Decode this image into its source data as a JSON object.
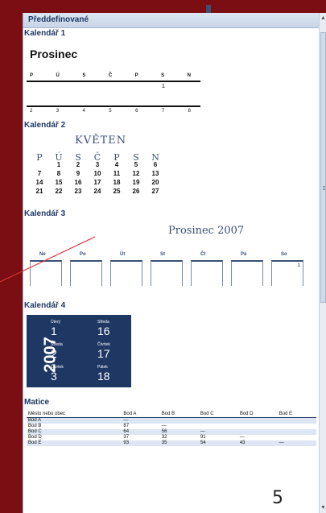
{
  "panel": {
    "header": "Předdefinované",
    "sections": [
      {
        "label": "Kalendář 1"
      },
      {
        "label": "Kalendář 2"
      },
      {
        "label": "Kalendář 3"
      },
      {
        "label": "Kalendář 4"
      },
      {
        "label": "Matice"
      }
    ]
  },
  "cal1": {
    "title": "Prosinec",
    "days": [
      "P",
      "Ú",
      "S",
      "Č",
      "P",
      "S",
      "N"
    ],
    "first": "1",
    "row2": [
      "2",
      "3",
      "4",
      "5",
      "6",
      "7",
      "8"
    ]
  },
  "cal2": {
    "title": "KVĚTEN",
    "days": [
      "P",
      "Ú",
      "S",
      "Č",
      "P",
      "S",
      "N"
    ],
    "rows": [
      [
        "",
        "1",
        "2",
        "3",
        "4",
        "5",
        "6"
      ],
      [
        "7",
        "8",
        "9",
        "10",
        "11",
        "12",
        "13"
      ],
      [
        "14",
        "15",
        "16",
        "17",
        "18",
        "19",
        "20"
      ],
      [
        "21",
        "22",
        "23",
        "24",
        "25",
        "26",
        "27"
      ]
    ]
  },
  "cal3": {
    "title": "Prosinec 2007",
    "days": [
      "Ne",
      "Po",
      "Út",
      "St",
      "Čt",
      "Pá",
      "So"
    ],
    "first": "1"
  },
  "cal4": {
    "year": "2007",
    "cells": [
      {
        "weekday": "Úterý",
        "day": "1"
      },
      {
        "weekday": "Středa",
        "day": "16"
      },
      {
        "weekday": "Středa",
        "day": "2"
      },
      {
        "weekday": "Čtvrtek",
        "day": "17"
      },
      {
        "weekday": "Čtvrtek",
        "day": "3"
      },
      {
        "weekday": "Pátek",
        "day": "18"
      }
    ]
  },
  "matrix": {
    "headers": [
      "Město nebo obec",
      "Bod A",
      "Bod B",
      "Bod C",
      "Bod D",
      "Bod E"
    ],
    "rows": [
      [
        "Bod A",
        "—",
        "",
        "",
        "",
        ""
      ],
      [
        "Bod B",
        "87",
        "—",
        "",
        "",
        ""
      ],
      [
        "Bod C",
        "64",
        "56",
        "—",
        "",
        ""
      ],
      [
        "Bod D",
        "37",
        "32",
        "91",
        "—",
        ""
      ],
      [
        "Bod E",
        "93",
        "35",
        "54",
        "43",
        "—"
      ]
    ]
  },
  "slide": {
    "page_number": "5"
  },
  "colors": {
    "background": "#7a0e12",
    "accent": "#1f3863",
    "header_bg": "#dde6f2"
  }
}
